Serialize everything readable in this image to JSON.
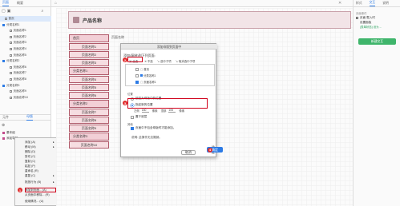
{
  "left_panel": {
    "tabs": [
      "页面",
      "概要"
    ],
    "tree": [
      {
        "label": "首页",
        "level": 1,
        "type": "page",
        "selected": true
      },
      {
        "label": "分类名称1",
        "level": 0,
        "type": "folder"
      },
      {
        "label": "页面名称1",
        "level": 2,
        "type": "page"
      },
      {
        "label": "页面名称2",
        "level": 2,
        "type": "page"
      },
      {
        "label": "页面名称3",
        "level": 2,
        "type": "page"
      },
      {
        "label": "页面名称4",
        "level": 2,
        "type": "page"
      },
      {
        "label": "页面名称5",
        "level": 2,
        "type": "page"
      },
      {
        "label": "分类名称2",
        "level": 0,
        "type": "folder"
      },
      {
        "label": "页面名称6",
        "level": 2,
        "type": "page"
      },
      {
        "label": "页面名称7",
        "level": 2,
        "type": "page"
      },
      {
        "label": "页面名称8",
        "level": 2,
        "type": "page"
      },
      {
        "label": "分类名称3",
        "level": 0,
        "type": "folder"
      },
      {
        "label": "页面名称9",
        "level": 2,
        "type": "page"
      },
      {
        "label": "页面名称10",
        "level": 2,
        "type": "page"
      }
    ],
    "bottom_tabs": [
      "元件",
      "母版"
    ],
    "bottom_items": [
      "基本组",
      "添加导航"
    ]
  },
  "context_menu": {
    "items": [
      {
        "label": "添加 (A)",
        "arrow": true
      },
      {
        "label": "移动 (M)",
        "arrow": true
      },
      {
        "label": "删除 (D)",
        "arrow": false
      },
      {
        "label": "剪切 (C)",
        "arrow": false
      },
      {
        "label": "复制 (C)",
        "arrow": false
      },
      {
        "label": "粘贴 (P)",
        "arrow": false
      },
      {
        "label": "重命名 (R)",
        "arrow": false
      },
      {
        "label": "重复 (C)",
        "arrow": true
      },
      {
        "label": "拖放行为 (B)",
        "arrow": true
      },
      {
        "label": "添加到页面... (A)",
        "arrow": false,
        "highlight": true
      },
      {
        "label": "从页面中移除... (R)",
        "arrow": false
      },
      {
        "label": "使用情况... (U)",
        "arrow": false
      }
    ],
    "badge": "1"
  },
  "canvas": {
    "title": "产品名称",
    "pagename_label": "页面名称",
    "nav_main": [
      "首页",
      "分类名称1",
      "分类名称2",
      "分类名称3"
    ],
    "nav_sub": [
      "页面名称1",
      "页面名称2",
      "页面名称3",
      "页面名称4",
      "页面名称5",
      "页面名称6",
      "页面名称7",
      "页面名称8",
      "页面名称9",
      "页面名称10"
    ]
  },
  "dialog": {
    "title": "添加母版到页面中",
    "instruction": "添加(复制)到下列页面:",
    "toolbar": [
      "全选",
      "不选",
      "选中子项",
      "取消选中子项"
    ],
    "tree": [
      "首页",
      "分类名称1",
      "页面名称1"
    ],
    "position_heading": "位置",
    "lock_option": "锁定为母版中的位置",
    "specific_option": "指定新的位置",
    "position_row": {
      "left_label": "左侧",
      "left_value": "180",
      "unit1": "像素",
      "top_label": "顶部",
      "top_value": "105",
      "unit2": "像素"
    },
    "bottom_option": "置于底层",
    "other_heading": "其他",
    "other_option": "页面中不包含母版时才能添加。",
    "note": "说明: 此操作无法撤销。",
    "cancel": "取消",
    "ok": "确定",
    "badges": [
      "2",
      "3",
      "4"
    ]
  },
  "right_panel": {
    "tabs": [
      "样式",
      "交互",
      "说明"
    ],
    "section": "页面事件",
    "event": "页面 载入时",
    "case": "设置面板",
    "detail": "(表单状态) 设为 ...",
    "new_button": "新建交互"
  },
  "colors": {
    "accent": "#2d7be5",
    "nav_fill": "#f6dde1",
    "nav_border": "#b05a6a",
    "header_fill": "#f2e4e7",
    "badge": "#e02d2d",
    "green_button": "#3fb56b"
  }
}
